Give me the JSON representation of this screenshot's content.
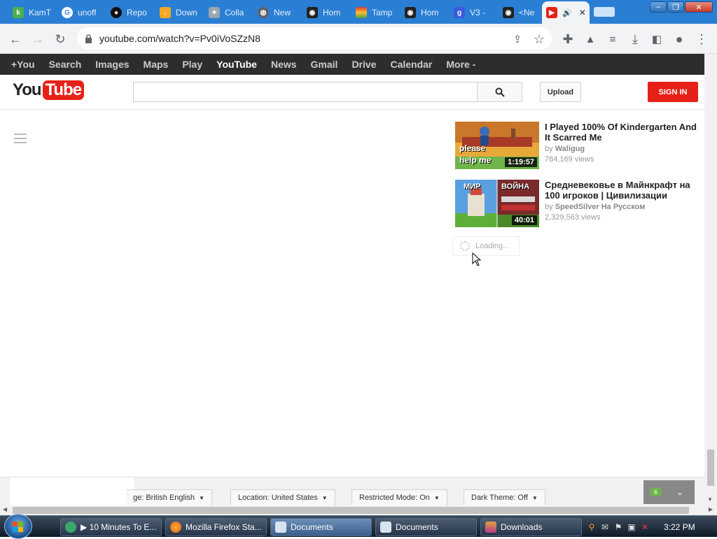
{
  "tabs": [
    {
      "title": "KamT",
      "icon": "kamt-favicon-icon"
    },
    {
      "title": "unoff",
      "icon": "google-favicon-icon"
    },
    {
      "title": "Repo",
      "icon": "github-favicon-icon"
    },
    {
      "title": "Down",
      "icon": "download-favicon-icon"
    },
    {
      "title": "Colla",
      "icon": "colab-favicon-icon"
    },
    {
      "title": "New",
      "icon": "globe-favicon-icon"
    },
    {
      "title": "Hom",
      "icon": "tampermonkey-favicon-icon"
    },
    {
      "title": "Tamp",
      "icon": "rainbow-favicon-icon"
    },
    {
      "title": "Hom",
      "icon": "tampermonkey-favicon-icon"
    },
    {
      "title": "V3 -",
      "icon": "google-plus-favicon-icon"
    },
    {
      "title": "<Ne",
      "icon": "tampermonkey-favicon-icon"
    },
    {
      "title": "",
      "icon": "youtube-favicon-icon",
      "active": true
    }
  ],
  "toolbar": {
    "url": "youtube.com/watch?v=Pv0iVoSZzN8"
  },
  "gbar": {
    "items": [
      "+You",
      "Search",
      "Images",
      "Maps",
      "Play",
      "YouTube",
      "News",
      "Gmail",
      "Drive",
      "Calendar",
      "More -"
    ],
    "active": "YouTube"
  },
  "header": {
    "logo_you": "You",
    "logo_tube": "Tube",
    "upload_label": "Upload",
    "signin_label": "SIGN IN"
  },
  "sidebar_videos": [
    {
      "title": "I Played 100% Of Kindergarten And It Scarred Me",
      "by_prefix": "by",
      "channel": "Waligug",
      "views": "784,169 views",
      "duration": "1:19:57",
      "thumb_text": [
        "please",
        "help me"
      ]
    },
    {
      "title": "Средневековье в Майнкрафт на 100 игроков | Цивилизации",
      "by_prefix": "by",
      "channel": "SpeedSilver На Русском",
      "views": "2,329,563 views",
      "duration": "40:01",
      "thumb_text": [
        "МИР",
        "ВОЙНА"
      ]
    }
  ],
  "loading_label": "Loading...",
  "footer": {
    "language": "ge: British English",
    "location": "Location: United States",
    "restricted": "Restricted Mode: On",
    "dark_theme": "Dark Theme: Off",
    "widget_badge": "6"
  },
  "taskbar": {
    "tasks": [
      {
        "label": "▶ 10 Minutes To E...",
        "icon": "media-player-icon"
      },
      {
        "label": "Mozilla Firefox Sta...",
        "icon": "firefox-icon"
      },
      {
        "label": "Documents",
        "icon": "folder-icon",
        "active": true
      },
      {
        "label": "Documents",
        "icon": "folder-icon"
      },
      {
        "label": "Downloads",
        "icon": "folder-icon"
      }
    ],
    "clock": "3:22 PM"
  },
  "colors": {
    "tabstrip": "#2a7fd4",
    "gbar": "#2d2d2d",
    "youtube_red": "#e62117",
    "taskbar": "#1c2a3a"
  }
}
